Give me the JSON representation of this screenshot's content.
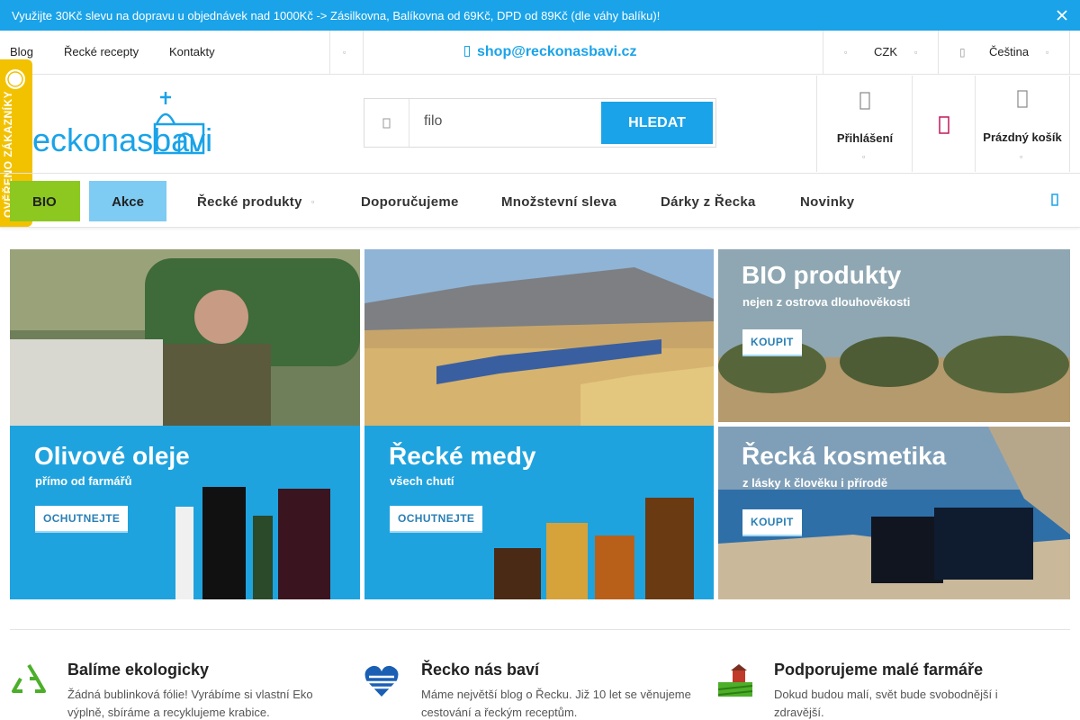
{
  "notice": {
    "text": "Využijte 30Kč slevu na dopravu u objednávek nad 1000Kč -> Zásilkovna, Balíkovna od 69Kč, DPD od 89Kč (dle váhy balíku)! ",
    "close_icon": "close-icon"
  },
  "topnav": {
    "links": [
      "Blog",
      "Řecké recepty",
      "Kontakty"
    ],
    "email": "shop@reckonasbavi.cz",
    "currency": "CZK",
    "language": "Čeština"
  },
  "logo": {
    "text": "eckonasbavi.cz",
    "mark": "R"
  },
  "badge": {
    "text": "OVĚŘENO ZÁKAZNÍKY"
  },
  "search": {
    "value": "filo",
    "button_label": "HLEDAT"
  },
  "account": {
    "login_label": "Přihlášení",
    "cart_label": "Prázdný košík"
  },
  "nav": {
    "bio": "BIO",
    "akce": "Akce",
    "items": [
      "Řecké produkty",
      "Doporučujeme",
      "Množstevní sleva",
      "Dárky z Řecka",
      "Novinky"
    ]
  },
  "banners": {
    "oils": {
      "title": "Olivové oleje",
      "subtitle": "přímo od farmářů",
      "cta": "OCHUTNEJTE"
    },
    "honey": {
      "title": "Řecké medy",
      "subtitle": "všech chutí",
      "cta": "OCHUTNEJTE"
    },
    "bio": {
      "title": "BIO produkty",
      "subtitle": "nejen z ostrova dlouhověkosti",
      "cta": "KOUPIT"
    },
    "cosmetics": {
      "title": "Řecká kosmetika",
      "subtitle": "z lásky k člověku i přírodě",
      "cta": "KOUPIT"
    }
  },
  "features": [
    {
      "title": "Balíme ekologicky",
      "desc": "Žádná bublinková fólie! Vyrábíme si vlastní Eko výplně, sbíráme a recyklujeme krabice.",
      "icon": "recycle-icon"
    },
    {
      "title": "Řecko nás baví",
      "desc": "Máme největší blog o Řecku. Již 10 let se věnujeme cestování a řeckým receptům.",
      "icon": "greek-flag-heart-icon"
    },
    {
      "title": "Podporujeme malé farmáře",
      "desc": "Dokud budou malí, svět bude svobodnější i zdravější.",
      "icon": "farm-icon"
    }
  ],
  "colors": {
    "accent": "#1aa3e8",
    "bio": "#8cc820",
    "akce": "#7ecbf3",
    "badge": "#f2c200",
    "panel": "#1fa3de"
  }
}
